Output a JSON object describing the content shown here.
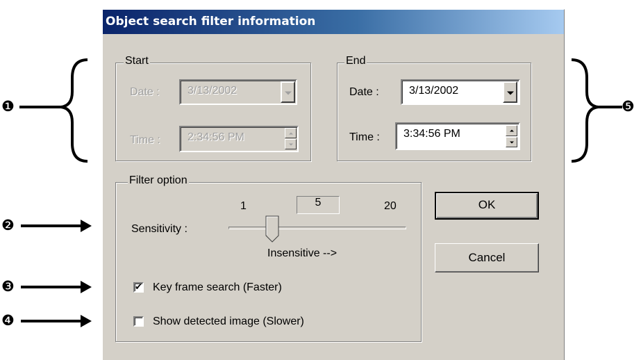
{
  "dialog": {
    "title": "Object search filter information"
  },
  "start": {
    "legend": "Start",
    "date_label": "Date :",
    "date_value": "3/13/2002",
    "time_label": "Time :",
    "time_value": "2:34:56 PM",
    "enabled": false
  },
  "end": {
    "legend": "End",
    "date_label": "Date :",
    "date_value": "3/13/2002",
    "time_label": "Time :",
    "time_value": "3:34:56 PM",
    "enabled": true
  },
  "filter": {
    "legend": "Filter option",
    "sensitivity_label": "Sensitivity :",
    "slider_min": "1",
    "slider_value": "5",
    "slider_max": "20",
    "slider_caption": "Insensitive -->",
    "key_frame_label": "Key frame search (Faster)",
    "key_frame_checked": true,
    "show_image_label": "Show detected image (Slower)",
    "show_image_checked": false
  },
  "buttons": {
    "ok": "OK",
    "cancel": "Cancel"
  },
  "annotations": {
    "m1": "❶",
    "m2": "❷",
    "m3": "❸",
    "m4": "❹",
    "m5": "❺"
  },
  "icons": [
    "dropdown-arrow-icon",
    "spin-up-icon",
    "spin-down-icon",
    "checkmark-icon",
    "slider-thumb-icon"
  ],
  "colors": {
    "title_gradient_start": "#0a246a",
    "title_gradient_end": "#a6caf0",
    "dialog_face": "#d4d0c8"
  }
}
